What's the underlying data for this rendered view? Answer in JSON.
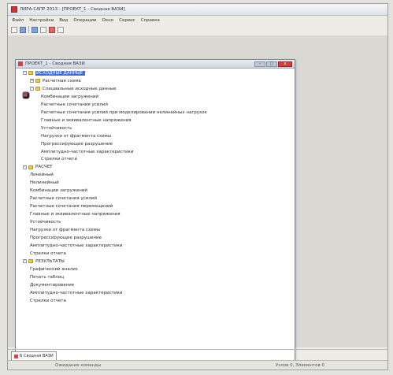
{
  "window": {
    "title": "ЛИРА-САПР 2013 - [ПРОЕКТ_1 - Сводная ВАЗИ]",
    "menu": [
      "Файл",
      "Настройки",
      "Вид",
      "Операции",
      "Окно",
      "Сервис",
      "Справка"
    ],
    "toolbar_icons": [
      "new-file-icon",
      "open-icon",
      "save-icon",
      "print-icon",
      "close-icon",
      "grid-icon"
    ]
  },
  "document": {
    "title": "ПРОЕКТ_1 - Сводная ВАЗИ",
    "buttons": [
      "–",
      "□",
      "x"
    ]
  },
  "tree": [
    {
      "level": 0,
      "type": "folder",
      "expander": "–",
      "label": "ИСХОДНЫЕ ДАННЫЕ",
      "selected": true
    },
    {
      "level": 1,
      "type": "folder",
      "expander": "+",
      "label": "Расчетная схема"
    },
    {
      "level": 1,
      "type": "folder",
      "expander": "–",
      "label": "Специальные исходные данные"
    },
    {
      "level": 2,
      "type": "doc",
      "label": "Комбинации загружений"
    },
    {
      "level": 2,
      "type": "doc",
      "label": "Расчетные сочетания усилий"
    },
    {
      "level": 2,
      "type": "doc",
      "label": "Расчетные сочетания усилий при моделировании нелинейных нагрузок"
    },
    {
      "level": 2,
      "type": "doc",
      "label": "Главные и эквивалентные напряжения"
    },
    {
      "level": 2,
      "type": "doc",
      "label": "Устойчивость"
    },
    {
      "level": 2,
      "type": "doc",
      "label": "Нагрузки от фрагмента схемы"
    },
    {
      "level": 2,
      "type": "doc",
      "label": "Прогрессирующее разрушение"
    },
    {
      "level": 2,
      "type": "doc",
      "label": "Амплитудно-частотные характеристики"
    },
    {
      "level": 2,
      "type": "doc",
      "label": "Стрелки отчета"
    },
    {
      "level": 0,
      "type": "folder",
      "expander": "–",
      "label": "РАСЧЕТ"
    },
    {
      "level": 1,
      "type": "doc",
      "label": "Линейный"
    },
    {
      "level": 1,
      "type": "doc",
      "label": "Нелинейный"
    },
    {
      "level": 1,
      "type": "doc",
      "label": "Комбинации загружений"
    },
    {
      "level": 1,
      "type": "doc",
      "label": "Расчетные сочетания усилий"
    },
    {
      "level": 1,
      "type": "doc",
      "label": "Расчетные сочетания перемещений"
    },
    {
      "level": 1,
      "type": "doc",
      "label": "Главные и эквивалентные напряжения"
    },
    {
      "level": 1,
      "type": "doc",
      "label": "Устойчивость"
    },
    {
      "level": 1,
      "type": "doc",
      "label": "Нагрузки от фрагмента схемы"
    },
    {
      "level": 1,
      "type": "doc",
      "label": "Прогрессирующее разрушение"
    },
    {
      "level": 1,
      "type": "doc",
      "label": "Амплитудно-частотные характеристики"
    },
    {
      "level": 1,
      "type": "doc",
      "label": "Стрелки отчета"
    },
    {
      "level": 0,
      "type": "folder",
      "expander": "–",
      "label": "РЕЗУЛЬТАТЫ"
    },
    {
      "level": 1,
      "type": "doc",
      "label": "Графический анализ"
    },
    {
      "level": 1,
      "type": "doc",
      "label": "Печать таблиц"
    },
    {
      "level": 1,
      "type": "doc",
      "label": "Документирование"
    },
    {
      "level": 1,
      "type": "doc",
      "label": "Амплитудно-частотные характеристики"
    },
    {
      "level": 1,
      "type": "doc",
      "label": "Стрелки отчета"
    }
  ],
  "tabs": [
    {
      "label": "Б Сводная ВАЗИ"
    }
  ],
  "status": {
    "left": "Ожидание команды",
    "right": "Узлов 0, Элементов 0"
  }
}
